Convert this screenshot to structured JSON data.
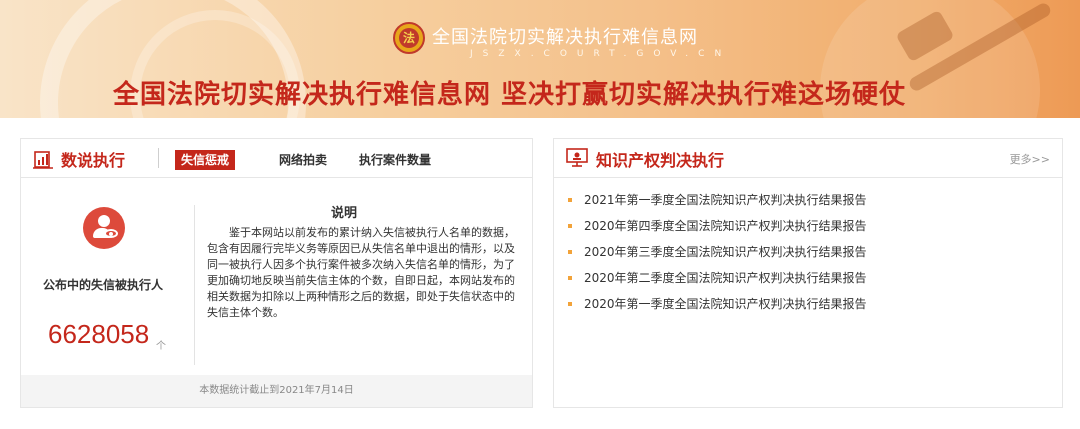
{
  "banner": {
    "site_name": "全国法院切实解决执行难信息网",
    "site_domain": "JSZX.COURT.GOV.CN",
    "slogan": "全国法院切实解决执行难信息网  坚决打赢切实解决执行难这场硬仗",
    "emblem_glyph": "法"
  },
  "left_panel": {
    "title": "数说执行",
    "tabs": [
      "失信惩戒",
      "网络拍卖",
      "执行案件数量"
    ],
    "active_tab": "失信惩戒",
    "count_label": "公布中的失信被执行人",
    "count_value": "6628058",
    "count_unit": "个",
    "note_title": "说明",
    "note_body": "鉴于本网站以前发布的累计纳入失信被执行人名单的数据，包含有因履行完毕义务等原因已从失信名单中退出的情形，以及同一被执行人因多个执行案件被多次纳入失信名单的情形，为了更加确切地反映当前失信主体的个数，自即日起，本网站发布的相关数据为扣除以上两种情形之后的数据，即处于失信状态中的失信主体个数。",
    "footer": "本数据统计截止到2021年7月14日"
  },
  "right_panel": {
    "title": "知识产权判决执行",
    "more": "更多>>",
    "items": [
      "2021年第一季度全国法院知识产权判决执行结果报告",
      "2020年第四季度全国法院知识产权判决执行结果报告",
      "2020年第三季度全国法院知识产权判决执行结果报告",
      "2020年第二季度全国法院知识产权判决执行结果报告",
      "2020年第一季度全国法院知识产权判决执行结果报告"
    ]
  },
  "colors": {
    "accent": "#c4271b",
    "bullet": "#f2a33a"
  }
}
